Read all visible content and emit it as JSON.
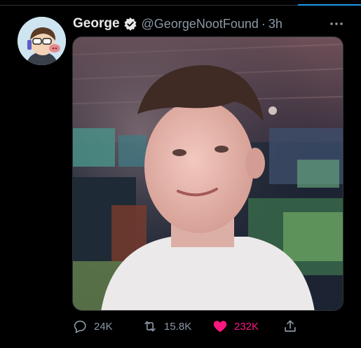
{
  "tweet": {
    "author_name": "George",
    "handle": "@GeorgeNootFound",
    "separator": "·",
    "time": "3h"
  },
  "actions": {
    "reply_count": "24K",
    "retweet_count": "15.8K",
    "like_count": "232K"
  },
  "colors": {
    "accent": "#1d9bf0",
    "like": "#f91880",
    "muted": "#8b98a5",
    "background": "#000000"
  },
  "icons": {
    "verified": "verified-badge-icon",
    "more": "more-horizontal-icon",
    "reply": "reply-icon",
    "retweet": "retweet-icon",
    "like": "heart-icon",
    "share": "share-icon"
  }
}
